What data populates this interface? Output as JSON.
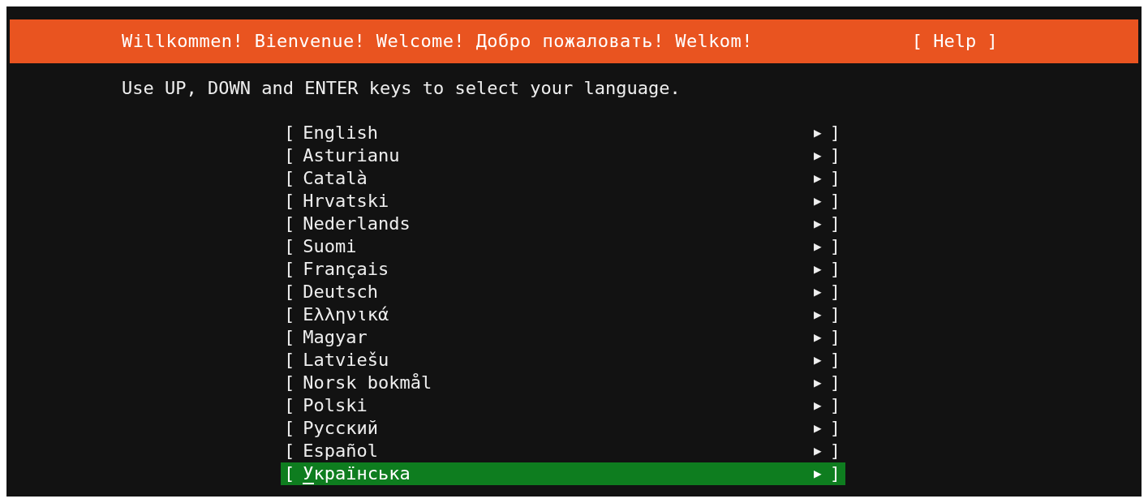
{
  "header": {
    "title": "Willkommen! Bienvenue! Welcome! Добро пожаловать! Welkom!",
    "help": "[ Help ]"
  },
  "instruction": "Use UP, DOWN and ENTER keys to select your language.",
  "languages": [
    {
      "open": "[",
      "label": "English",
      "arrow": "▶",
      "close": "]",
      "selected": false
    },
    {
      "open": "[",
      "label": "Asturianu",
      "arrow": "▶",
      "close": "]",
      "selected": false
    },
    {
      "open": "[",
      "label": "Català",
      "arrow": "▶",
      "close": "]",
      "selected": false
    },
    {
      "open": "[",
      "label": "Hrvatski",
      "arrow": "▶",
      "close": "]",
      "selected": false
    },
    {
      "open": "[",
      "label": "Nederlands",
      "arrow": "▶",
      "close": "]",
      "selected": false
    },
    {
      "open": "[",
      "label": "Suomi",
      "arrow": "▶",
      "close": "]",
      "selected": false
    },
    {
      "open": "[",
      "label": "Français",
      "arrow": "▶",
      "close": "]",
      "selected": false
    },
    {
      "open": "[",
      "label": "Deutsch",
      "arrow": "▶",
      "close": "]",
      "selected": false
    },
    {
      "open": "[",
      "label": "Ελληνικά",
      "arrow": "▶",
      "close": "]",
      "selected": false
    },
    {
      "open": "[",
      "label": "Magyar",
      "arrow": "▶",
      "close": "]",
      "selected": false
    },
    {
      "open": "[",
      "label": "Latviešu",
      "arrow": "▶",
      "close": "]",
      "selected": false
    },
    {
      "open": "[",
      "label": "Norsk bokmål",
      "arrow": "▶",
      "close": "]",
      "selected": false
    },
    {
      "open": "[",
      "label": "Polski",
      "arrow": "▶",
      "close": "]",
      "selected": false
    },
    {
      "open": "[",
      "label": "Русский",
      "arrow": "▶",
      "close": "]",
      "selected": false
    },
    {
      "open": "[",
      "label": "Español",
      "arrow": "▶",
      "close": "]",
      "selected": false
    },
    {
      "open": "[",
      "label": "Українська",
      "arrow": "▶",
      "close": "]",
      "selected": true
    }
  ]
}
